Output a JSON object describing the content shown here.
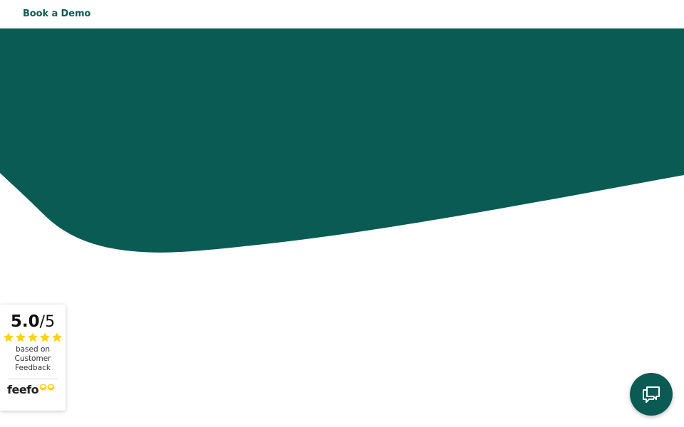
{
  "header": {
    "book_demo_label": "Book a Demo"
  },
  "colors": {
    "brand_green": "#0b5b55",
    "star_yellow": "#fcd215",
    "background": "#ffffff"
  },
  "feefo_badge": {
    "score": "5.0",
    "max": "/5",
    "stars": 5,
    "based_on_lines": [
      "based on",
      "Customer",
      "Feedback"
    ],
    "logo_text": "feefo",
    "icons": [
      "star-icon",
      "feefo-eyes-icon"
    ]
  },
  "chat_widget": {
    "icon": "chat-bubble-icon"
  }
}
